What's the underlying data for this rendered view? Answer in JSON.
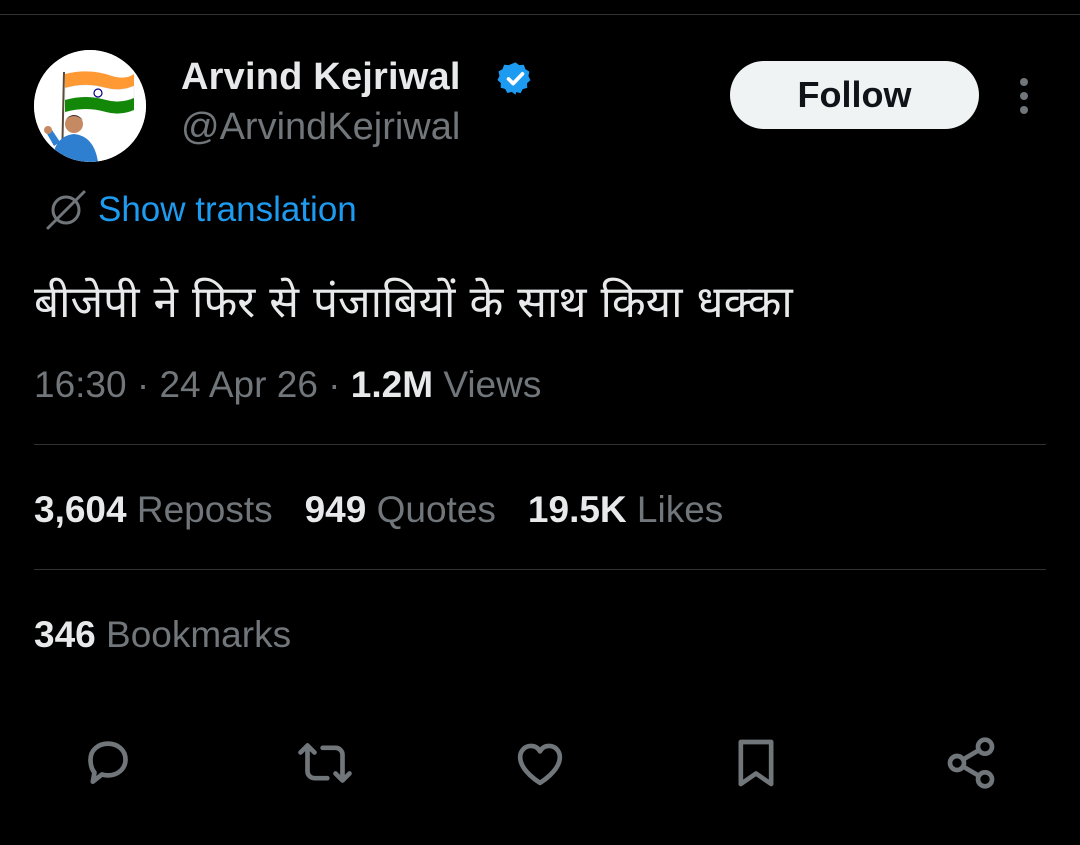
{
  "tweet": {
    "author": {
      "display_name": "Arvind Kejriwal",
      "handle": "@ArvindKejriwal",
      "verified": true,
      "avatar_icon": "avatar-with-flag"
    },
    "follow_label": "Follow",
    "more_icon": "more-vertical-icon",
    "translate_label": "Show translation",
    "text": "बीजेपी ने फिर से पंजाबियों के साथ किया  धक्का",
    "meta": {
      "time": "16:30",
      "sep1": " · ",
      "date": "24 Apr 26",
      "sep2": " · ",
      "views_count": "1.2M",
      "views_label": " Views"
    },
    "stats": {
      "reposts_count": "3,604",
      "reposts_label": " Reposts",
      "quotes_count": "949",
      "quotes_label": " Quotes",
      "likes_count": "19.5K",
      "likes_label": " Likes",
      "bookmarks_count": "346",
      "bookmarks_label": " Bookmarks"
    },
    "actions": [
      "reply-icon",
      "repost-icon",
      "like-icon",
      "bookmark-icon",
      "share-icon"
    ]
  },
  "colors": {
    "background": "#000000",
    "text_primary": "#e7e9ea",
    "text_secondary": "#71767b",
    "accent": "#1d9bf0",
    "divider": "#2f3336"
  }
}
